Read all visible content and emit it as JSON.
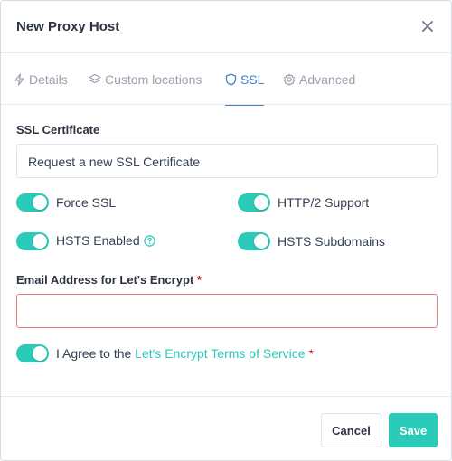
{
  "modal": {
    "title": "New Proxy Host"
  },
  "tabs": [
    {
      "label": "Details",
      "icon": "lightning-icon",
      "active": false
    },
    {
      "label": "Custom locations",
      "icon": "layers-icon",
      "active": false
    },
    {
      "label": "SSL",
      "icon": "shield-icon",
      "active": true
    },
    {
      "label": "Advanced",
      "icon": "gear-icon",
      "active": false
    }
  ],
  "ssl": {
    "certificate_label": "SSL Certificate",
    "certificate_value": "Request a new SSL Certificate",
    "toggles": {
      "force_ssl": {
        "label": "Force SSL",
        "on": true
      },
      "http2": {
        "label": "HTTP/2 Support",
        "on": true
      },
      "hsts": {
        "label": "HSTS Enabled",
        "on": true
      },
      "hsts_subdomains": {
        "label": "HSTS Subdomains",
        "on": true
      }
    },
    "email_label": "Email Address for Let's Encrypt",
    "email_required": "*",
    "email_value": "",
    "agree_prefix": "I Agree to the ",
    "agree_link": "Let's Encrypt Terms of Service",
    "agree_required": "*",
    "agree_on": true
  },
  "footer": {
    "cancel_label": "Cancel",
    "save_label": "Save"
  },
  "colors": {
    "accent": "#2bcbba",
    "tab_active": "#467fcf",
    "error_border": "#e37b7b",
    "required": "#cd201f"
  }
}
